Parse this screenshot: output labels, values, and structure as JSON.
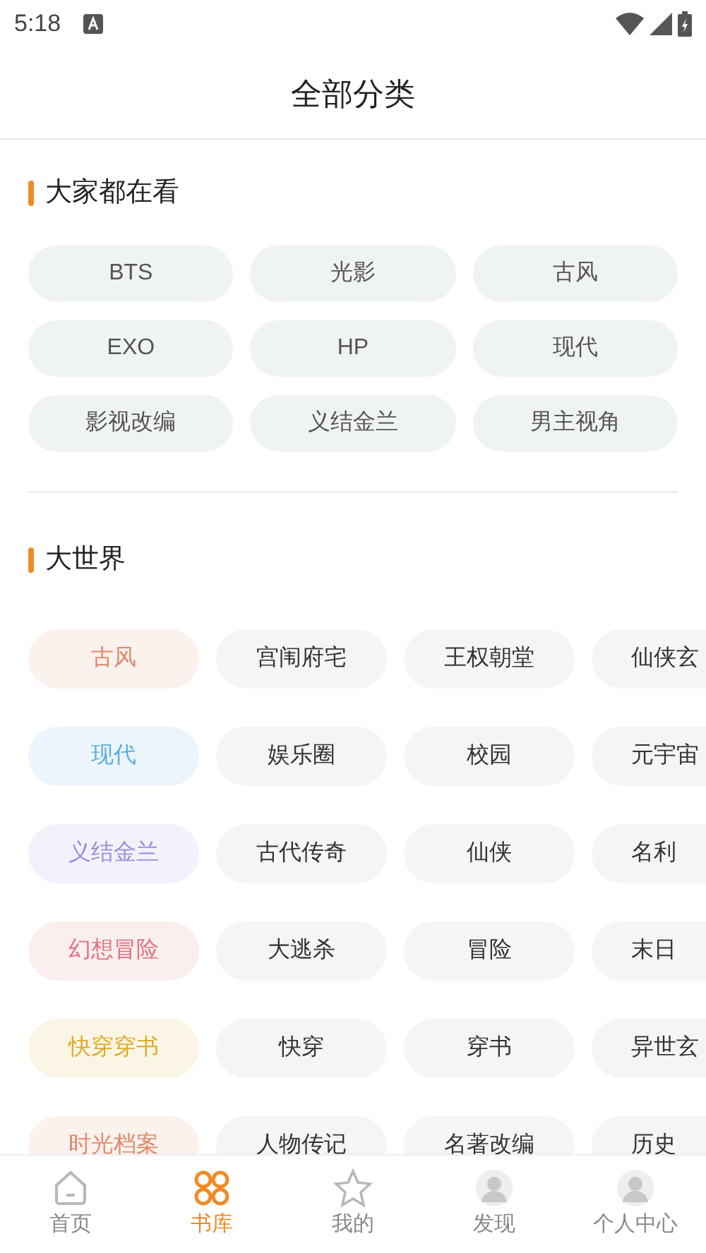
{
  "status_bar": {
    "time": "5:18"
  },
  "header": {
    "title": "全部分类"
  },
  "popular": {
    "title": "大家都在看",
    "tags": [
      "BTS",
      "光影",
      "古风",
      "EXO",
      "HP",
      "现代",
      "影视改编",
      "义结金兰",
      "男主视角"
    ]
  },
  "world": {
    "title": "大世界",
    "rows": [
      {
        "category": "古风",
        "color": "#e0896a",
        "tags": [
          "宫闱府宅",
          "王权朝堂",
          "仙侠玄"
        ]
      },
      {
        "category": "现代",
        "color": "#5eaee0",
        "tags": [
          "娱乐圈",
          "校园",
          "元宇宙"
        ]
      },
      {
        "category": "义结金兰",
        "color": "#9a8ce0",
        "tags": [
          "古代传奇",
          "仙侠",
          "名利"
        ]
      },
      {
        "category": "幻想冒险",
        "color": "#e0707e",
        "tags": [
          "大逃杀",
          "冒险",
          "末日"
        ]
      },
      {
        "category": "快穿穿书",
        "color": "#e0a92a",
        "tags": [
          "快穿",
          "穿书",
          "异世玄"
        ]
      },
      {
        "category": "时光档案",
        "color": "#e0896a",
        "tags": [
          "人物传记",
          "名著改编",
          "历史"
        ]
      }
    ]
  },
  "nav": [
    {
      "label": "首页",
      "kind": "home",
      "selected": false
    },
    {
      "label": "书库",
      "kind": "library",
      "selected": true
    },
    {
      "label": "我的",
      "kind": "star",
      "selected": false
    },
    {
      "label": "发现",
      "kind": "avatar",
      "selected": false
    },
    {
      "label": "个人中心",
      "kind": "avatar",
      "selected": false
    }
  ]
}
